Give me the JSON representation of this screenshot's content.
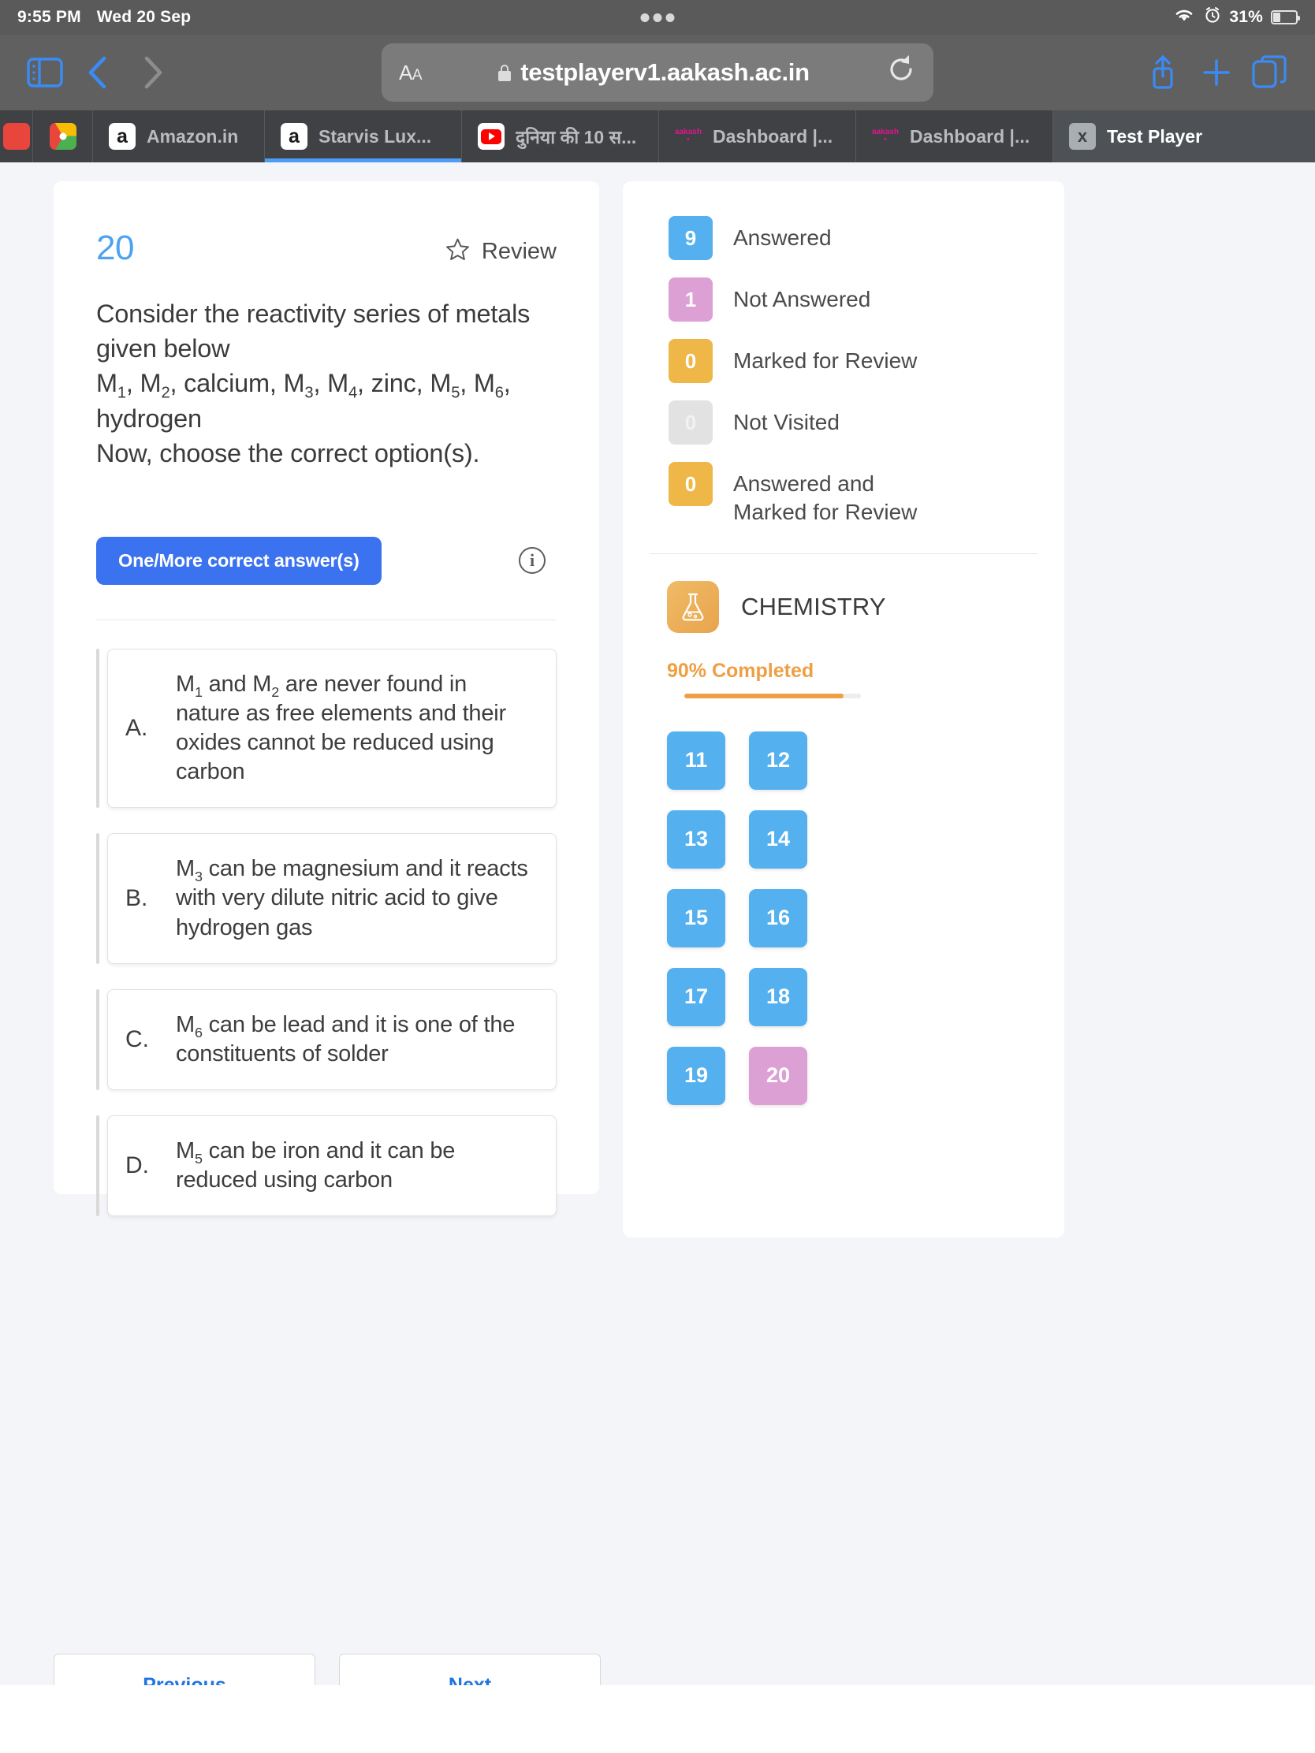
{
  "status_bar": {
    "time": "9:55 PM",
    "date": "Wed 20 Sep",
    "battery_percent": "31%",
    "wifi_icon": "wifi-icon",
    "alarm_icon": "alarm-icon",
    "battery_icon": "battery-icon",
    "dots_icon": "handoff-dots-icon"
  },
  "browser": {
    "sidebar_icon": "sidebar-toggle-icon",
    "back_icon": "back-chevron-icon",
    "forward_icon": "forward-chevron-icon",
    "aa_label": "A",
    "aa_label_small": "A",
    "lock_icon": "lock-icon",
    "url": "testplayerv1.aakash.ac.in",
    "reload_icon": "reload-icon",
    "share_icon": "share-icon",
    "new_tab_icon": "plus-icon",
    "tabs_icon": "tab-overview-icon",
    "tabs": [
      {
        "label": "",
        "favicon": "red-favicon",
        "truncated": true
      },
      {
        "label": "",
        "favicon": "chrome-favicon",
        "truncated": true
      },
      {
        "label": "Amazon.in",
        "favicon": "amazon-favicon"
      },
      {
        "label": "Starvis Lux...",
        "favicon": "amazon-favicon"
      },
      {
        "label": "दुनिया की 10 स...",
        "favicon": "youtube-favicon"
      },
      {
        "label": "Dashboard |...",
        "favicon": "aakash-favicon"
      },
      {
        "label": "Dashboard |...",
        "favicon": "aakash-favicon"
      },
      {
        "label": "Test Player",
        "favicon": "x-favicon",
        "active": true
      }
    ]
  },
  "question": {
    "number": "20",
    "review_label": "Review",
    "review_icon": "star-outline-icon",
    "info_icon": "info-icon",
    "type_badge": "One/More correct answer(s)",
    "stem_line1": "Consider the reactivity series of metals given below",
    "stem_line2_parts": [
      "M",
      "1",
      ", M",
      "2",
      ", calcium, M",
      "3",
      ", M",
      "4",
      ", zinc, M",
      "5",
      ", M",
      "6",
      ","
    ],
    "stem_line3": "hydrogen",
    "stem_line4": "Now, choose the correct option(s).",
    "options": [
      {
        "letter": "A.",
        "text_pre": "M",
        "sub1": "1",
        "text_mid": " and M",
        "sub2": "2",
        "text_post": " are never found in nature as free elements and their oxides cannot be reduced using carbon"
      },
      {
        "letter": "B.",
        "text_pre": "M",
        "sub1": "3",
        "text_mid": "",
        "sub2": "",
        "text_post": " can be magnesium and it reacts with very dilute nitric acid to give hydrogen gas"
      },
      {
        "letter": "C.",
        "text_pre": "M",
        "sub1": "6",
        "text_mid": "",
        "sub2": "",
        "text_post": " can be lead and it is one of the constituents of solder"
      },
      {
        "letter": "D.",
        "text_pre": "M",
        "sub1": "5",
        "text_mid": "",
        "sub2": "",
        "text_post": " can be iron and it can be reduced using carbon"
      }
    ]
  },
  "nav": {
    "previous_label": "Previous",
    "next_label": "Next"
  },
  "sidebar": {
    "legend": [
      {
        "count": "9",
        "label": "Answered",
        "color": "#54b0ef",
        "style": "blue"
      },
      {
        "count": "1",
        "label": "Not Answered",
        "color": "#dda0d5",
        "style": "pink"
      },
      {
        "count": "0",
        "label": "Marked for Review",
        "color": "#eeb748",
        "style": "amber"
      },
      {
        "count": "0",
        "label": "Not Visited",
        "color": "#e2e2e2",
        "style": "grey"
      },
      {
        "count": "0",
        "label": "Answered and Marked for Review",
        "color": "#eeb748",
        "style": "amber",
        "check_icon": "check-badge-icon"
      }
    ],
    "subject": {
      "name": "CHEMISTRY",
      "icon": "flask-icon",
      "progress_label": "90% Completed",
      "progress_percent": 90
    },
    "questions": [
      {
        "num": "11",
        "state": "answered"
      },
      {
        "num": "12",
        "state": "answered"
      },
      {
        "num": "13",
        "state": "answered"
      },
      {
        "num": "14",
        "state": "answered"
      },
      {
        "num": "15",
        "state": "answered"
      },
      {
        "num": "16",
        "state": "answered"
      },
      {
        "num": "17",
        "state": "answered"
      },
      {
        "num": "18",
        "state": "answered"
      },
      {
        "num": "19",
        "state": "answered"
      },
      {
        "num": "20",
        "state": "notanswered"
      }
    ]
  }
}
